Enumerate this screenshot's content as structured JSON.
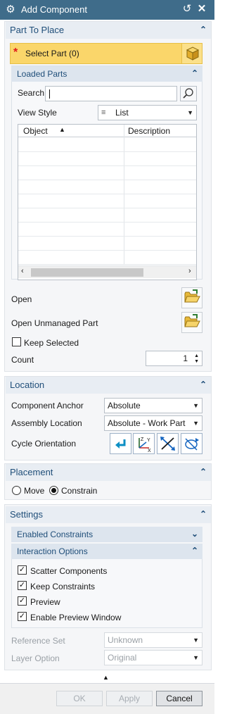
{
  "window": {
    "title": "Add Component",
    "reset_icon": "↺",
    "close_icon": "✕",
    "gear_icon": "⚙"
  },
  "part_to_place": {
    "header": "Part To Place",
    "select_part": "Select Part (0)",
    "loaded_parts": {
      "header": "Loaded Parts",
      "search_label": "Search",
      "search_value": "",
      "view_style_label": "View Style",
      "view_style_value": "List",
      "columns": [
        "Object",
        "Description"
      ],
      "rows": []
    },
    "open_label": "Open",
    "open_unmanaged_label": "Open Unmanaged Part",
    "keep_selected_label": "Keep Selected",
    "keep_selected_checked": false,
    "count_label": "Count",
    "count_value": "1"
  },
  "location": {
    "header": "Location",
    "component_anchor_label": "Component Anchor",
    "component_anchor_value": "Absolute",
    "assembly_location_label": "Assembly Location",
    "assembly_location_value": "Absolute - Work Part",
    "cycle_orientation_label": "Cycle Orientation"
  },
  "placement": {
    "header": "Placement",
    "move_label": "Move",
    "constrain_label": "Constrain",
    "selected": "Constrain"
  },
  "settings": {
    "header": "Settings",
    "enabled_constraints_header": "Enabled Constraints",
    "interaction_options_header": "Interaction Options",
    "options": [
      {
        "label": "Scatter Components",
        "checked": true
      },
      {
        "label": "Keep Constraints",
        "checked": true
      },
      {
        "label": "Preview",
        "checked": true
      },
      {
        "label": "Enable Preview Window",
        "checked": true
      }
    ],
    "reference_set_label": "Reference Set",
    "reference_set_value": "Unknown",
    "layer_option_label": "Layer Option",
    "layer_option_value": "Original"
  },
  "footer": {
    "ok_label": "OK",
    "apply_label": "Apply",
    "cancel_label": "Cancel"
  },
  "colors": {
    "titlebar": "#3f6c8a",
    "select_highlight": "#fad66a",
    "group_header_text": "#1f4e79"
  }
}
